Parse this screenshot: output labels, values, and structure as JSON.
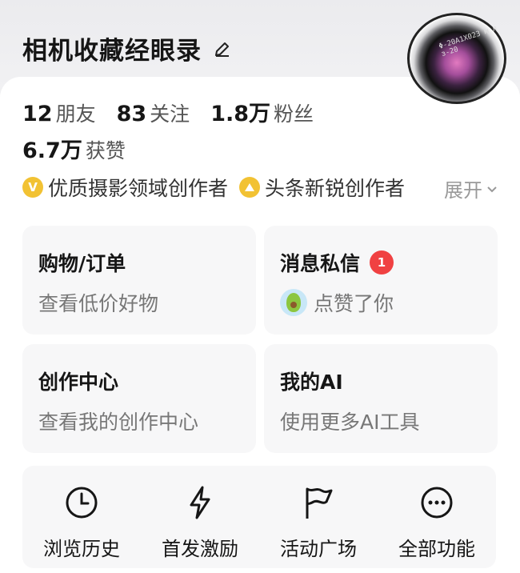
{
  "profile": {
    "username": "相机收藏经眼录",
    "avatar_text": "Φ-20A1X023  м л  з-20"
  },
  "stats": {
    "friends_count": "12",
    "friends_label": "朋友",
    "following_count": "83",
    "following_label": "关注",
    "followers_count": "1.8万",
    "followers_label": "粉丝",
    "likes_count": "6.7万",
    "likes_label": "获赞"
  },
  "badges": [
    {
      "icon_text": "V",
      "label": "优质摄影领域创作者",
      "icon": "v-badge-icon"
    },
    {
      "icon_text": "",
      "label": "头条新锐创作者",
      "icon": "rising-creator-icon"
    }
  ],
  "expand_label": "展开",
  "tiles": {
    "shopping": {
      "title": "购物/订单",
      "subtitle": "查看低价好物"
    },
    "messages": {
      "title": "消息私信",
      "count": "1",
      "subtitle": "点赞了你"
    },
    "creator": {
      "title": "创作中心",
      "subtitle": "查看我的创作中心"
    },
    "ai": {
      "title": "我的AI",
      "subtitle": "使用更多AI工具"
    }
  },
  "quick_actions": [
    {
      "label": "浏览历史",
      "icon": "clock-icon"
    },
    {
      "label": "首发激励",
      "icon": "lightning-icon"
    },
    {
      "label": "活动广场",
      "icon": "flag-icon"
    },
    {
      "label": "全部功能",
      "icon": "more-icon"
    }
  ],
  "colors": {
    "badge_gold": "#f2c233",
    "notification_red": "#f04142",
    "tile_bg": "#f7f7f8"
  }
}
